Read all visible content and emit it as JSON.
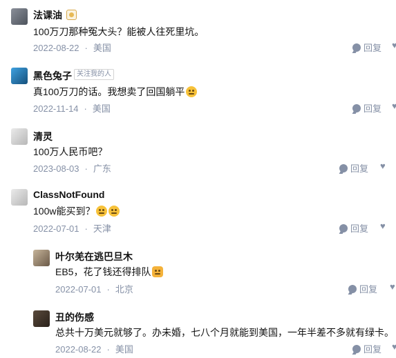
{
  "comments": [
    {
      "author": "法课油",
      "text": "100万刀那种冤大头？能被人往死里坑。",
      "date": "2022-08-22",
      "location": "美国",
      "reply": "回复"
    },
    {
      "author": "黑色兔子",
      "tag": "关注我的人",
      "text": "真100万刀的话。我想卖了回国躺平",
      "date": "2022-11-14",
      "location": "美国",
      "reply": "回复"
    },
    {
      "author": "清灵",
      "text": "100万人民币吧？",
      "date": "2023-08-03",
      "location": "广东",
      "reply": "回复"
    },
    {
      "author": "ClassNotFound",
      "text": "100w能买到？",
      "date": "2022-07-01",
      "location": "天津",
      "reply": "回复"
    }
  ],
  "replies": [
    {
      "author": "叶尔羌在逃巴旦木",
      "text": "EB5，花了钱还得排队",
      "date": "2022-07-01",
      "location": "北京",
      "reply": "回复"
    },
    {
      "author": "丑的伤感",
      "text": "总共十万美元就够了。办未婚，七八个月就能到美国，一年半差不多就有绿卡。",
      "date": "2022-08-22",
      "location": "美国",
      "reply": "回复"
    }
  ],
  "icons": {
    "reply": "comment-icon",
    "like": "heart-icon",
    "badge": "medal-icon"
  },
  "colors": {
    "meta": "#8590a6",
    "text": "#121212"
  }
}
